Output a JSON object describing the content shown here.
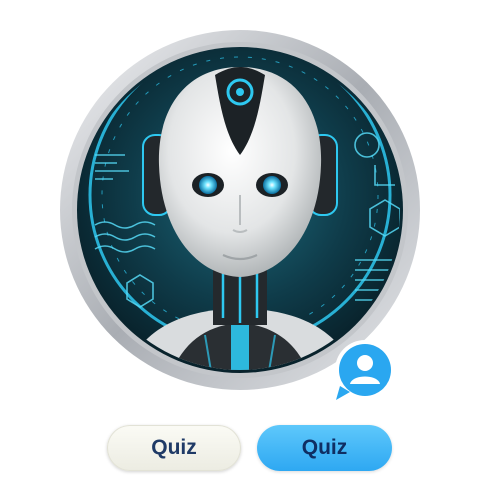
{
  "avatar": {
    "subject": "humanoid-robot-portrait",
    "accent_color": "#2ec8f0",
    "frame_color": "#c9ccd0",
    "background_color": "#0c2a36"
  },
  "badge": {
    "icon": "user-chat-icon",
    "color": "#2aa7f0"
  },
  "buttons": [
    {
      "label": "Quiz",
      "style": "light",
      "color": "#f2f2e8"
    },
    {
      "label": "Quiz",
      "style": "primary",
      "color": "#3cb4f5"
    }
  ]
}
